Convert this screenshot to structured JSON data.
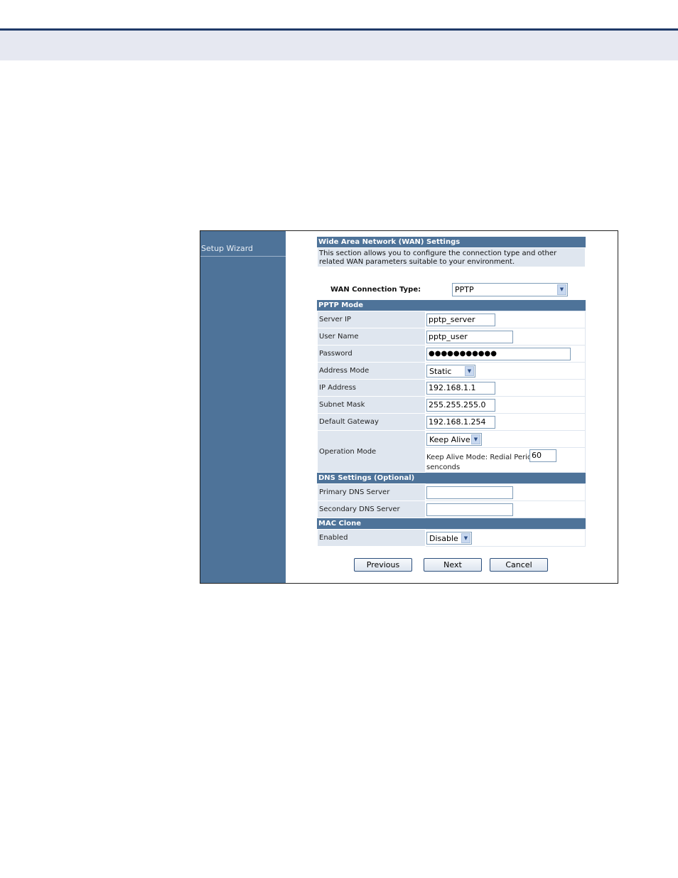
{
  "sidebar": {
    "items": [
      {
        "label": "Setup Wizard"
      }
    ]
  },
  "wan": {
    "title": "Wide Area Network (WAN) Settings",
    "description": "This section allows you to configure the connection type and other related WAN parameters suitable to your environment.",
    "connection_type_label": "WAN Connection Type:",
    "connection_type_value": "PPTP"
  },
  "pptp": {
    "title": "PPTP Mode",
    "server_ip": {
      "label": "Server IP",
      "value": "pptp_server"
    },
    "user_name": {
      "label": "User Name",
      "value": "pptp_user"
    },
    "password": {
      "label": "Password",
      "value": "●●●●●●●●●●●"
    },
    "address_mode": {
      "label": "Address Mode",
      "value": "Static"
    },
    "ip_address": {
      "label": "IP Address",
      "value": "192.168.1.1"
    },
    "subnet_mask": {
      "label": "Subnet Mask",
      "value": "255.255.255.0"
    },
    "default_gateway": {
      "label": "Default Gateway",
      "value": "192.168.1.254"
    },
    "operation_mode": {
      "label": "Operation Mode",
      "value": "Keep Alive",
      "redial_label": "Keep Alive Mode: Redial Period",
      "redial_value": "60",
      "redial_unit": "senconds"
    }
  },
  "dns": {
    "title": "DNS Settings (Optional)",
    "primary": {
      "label": "Primary DNS Server",
      "value": ""
    },
    "secondary": {
      "label": "Secondary DNS Server",
      "value": ""
    }
  },
  "mac_clone": {
    "title": "MAC Clone",
    "enabled": {
      "label": "Enabled",
      "value": "Disable"
    }
  },
  "buttons": {
    "previous": "Previous",
    "next": "Next",
    "cancel": "Cancel"
  },
  "colors": {
    "sidebar": "#4e7399",
    "section_bar": "#4e7399",
    "label_bg": "#dfe6ef",
    "header_band": "#e6e8f1",
    "header_line": "#1f3a68"
  }
}
